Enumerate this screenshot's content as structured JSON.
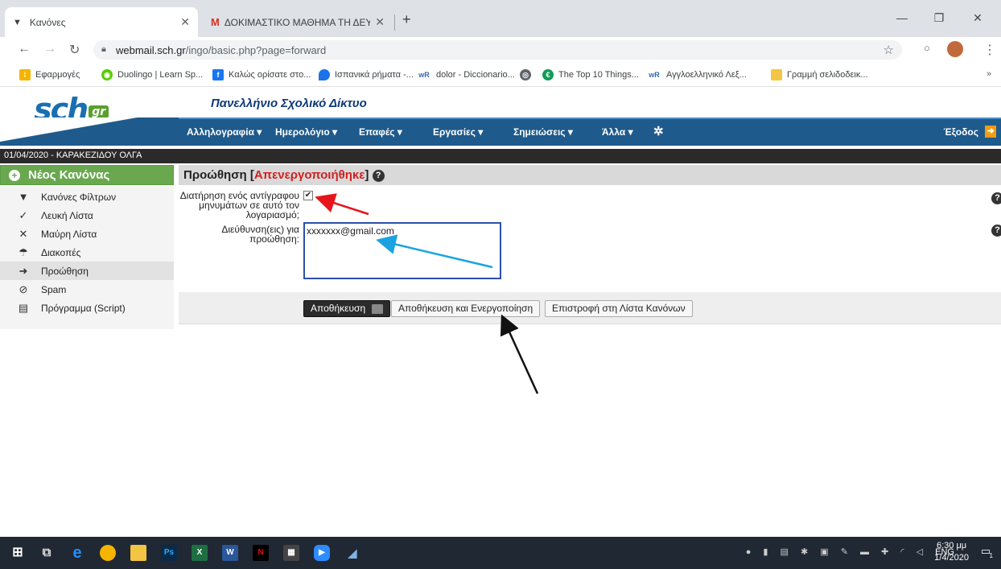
{
  "browser": {
    "tabs": [
      {
        "title": "Κανόνες",
        "active": true
      },
      {
        "title": "ΔΟΚΙΜΑΣΤΙΚΟ ΜΑΘΗΜΑ ΤΗ ΔΕΥ",
        "active": false
      }
    ],
    "new_tab_label": "+",
    "url_host": "webmail.sch.gr",
    "url_path": "/ingo/basic.php?page=forward",
    "window_controls": {
      "minimize": "—",
      "restore": "❐",
      "close": "✕"
    }
  },
  "bookmarks": [
    {
      "label": "Εφαρμογές",
      "icon": "apps-icon",
      "color": "#f4b400"
    },
    {
      "label": "Duolingo | Learn Sp...",
      "icon": "duolingo-icon",
      "color": "#58cc02"
    },
    {
      "label": "Καλώς ορίσατε στο...",
      "icon": "facebook-icon",
      "color": "#1877f2"
    },
    {
      "label": "Ισπανικά ρήματα -...",
      "icon": "location-icon",
      "color": "#1a73e8"
    },
    {
      "label": "dolor - Diccionario...",
      "icon": "wordreference-icon",
      "color": "#e8eaed"
    },
    {
      "label": "",
      "icon": "globe-icon",
      "color": "#5f6368"
    },
    {
      "label": "The Top 10 Things...",
      "icon": "bookmark-site-icon",
      "color": "#0f9d58"
    },
    {
      "label": "Αγγλοελληνικό Λεξ...",
      "icon": "wordreference-icon",
      "color": "#e8eaed"
    },
    {
      "label": "Γραμμή σελιδοδεικ...",
      "icon": "folder-icon",
      "color": "#f4c542"
    }
  ],
  "site": {
    "logo_text": "sch",
    "logo_suffix": "gr",
    "name": "Πανελλήνιο Σχολικό Δίκτυο",
    "nav": [
      "Αλληλογραφία ▾",
      "Ημερολόγιο ▾",
      "Επαφές ▾",
      "Εργασίες ▾",
      "Σημειώσεις ▾",
      "Άλλα ▾"
    ],
    "logout": "Έξοδος",
    "date_user": "01/04/2020 - ΚΑΡΑΚΕΖΙΔΟΥ ΟΛΓΑ"
  },
  "sidebar": {
    "new_rule": "Νέος Κανόνας",
    "items": [
      {
        "label": "Κανόνες Φίλτρων",
        "icon": "filter-icon",
        "glyph": "▼"
      },
      {
        "label": "Λευκή Λίστα",
        "icon": "check-circle-icon",
        "glyph": "✓"
      },
      {
        "label": "Μαύρη Λίστα",
        "icon": "x-circle-icon",
        "glyph": "✕"
      },
      {
        "label": "Διακοπές",
        "icon": "vacation-icon",
        "glyph": "☂"
      },
      {
        "label": "Προώθηση",
        "icon": "forward-arrow-icon",
        "glyph": "➜"
      },
      {
        "label": "Spam",
        "icon": "spam-icon",
        "glyph": "⊘"
      },
      {
        "label": "Πρόγραμμα (Script)",
        "icon": "script-icon",
        "glyph": "▤"
      }
    ],
    "active_index": 4
  },
  "form": {
    "title": "Προώθηση",
    "status": "Απενεργοποιήθηκε",
    "keep_copy_label": "Διατήρηση ενός αντίγραφου μηνυμάτων σε αυτό τον λογαριασμό;",
    "keep_copy_checked": true,
    "address_label": "Διεύθυνση(εις) για προώθηση:",
    "address_value": "xxxxxxx@gmail.com",
    "buttons": {
      "save": "Αποθήκευση",
      "save_enable": "Αποθήκευση και Ενεργοποίηση",
      "return": "Επιστροφή στη Λίστα Κανόνων"
    },
    "help_glyph": "?"
  },
  "annotations": {
    "arrow_colors": {
      "red": "#e8141b",
      "blue": "#1aa3e0",
      "black": "#111111"
    }
  },
  "taskbar": {
    "language": "ENG",
    "time": "6:30 μμ",
    "date": "1/4/2020",
    "notifications": "1"
  }
}
